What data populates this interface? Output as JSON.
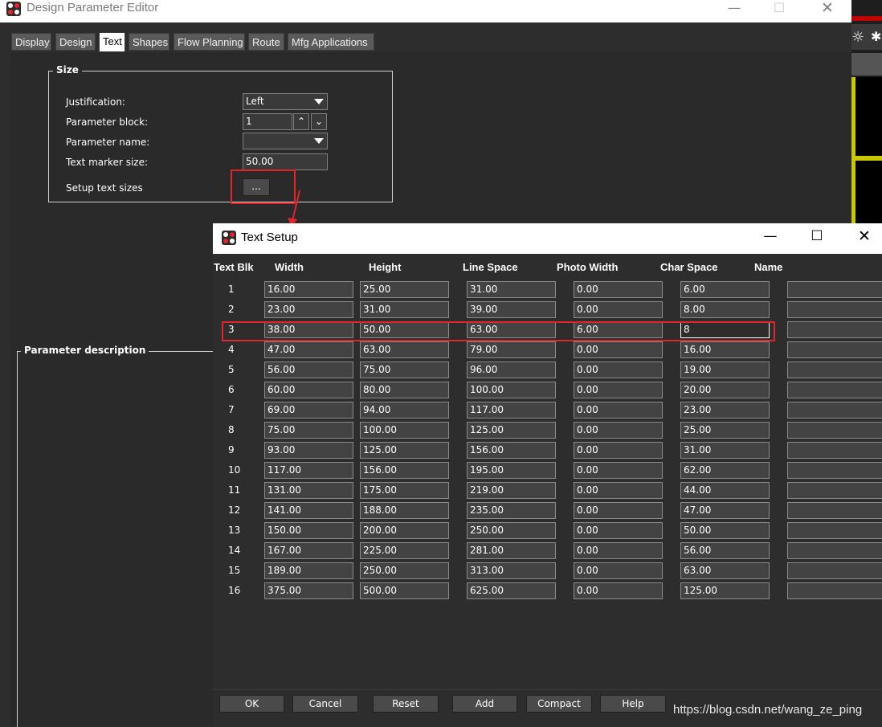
{
  "parent": {
    "title": "Design Parameter Editor",
    "tabs": [
      "Display",
      "Design",
      "Text",
      "Shapes",
      "Flow Planning",
      "Route",
      "Mfg Applications"
    ],
    "active_tab": "Text",
    "size_group": {
      "legend": "Size",
      "justification_label": "Justification:",
      "justification_value": "Left",
      "parameter_block_label": "Parameter block:",
      "parameter_block_value": "1",
      "parameter_name_label": "Parameter name:",
      "parameter_name_value": "",
      "text_marker_label": "Text marker size:",
      "text_marker_value": "50.00",
      "setup_text_label": "Setup text sizes",
      "setup_button": "..."
    },
    "description_group": {
      "legend": "Parameter description"
    }
  },
  "dialog": {
    "title": "Text Setup",
    "columns": [
      "Text Blk",
      "Width",
      "Height",
      "Line Space",
      "Photo Width",
      "Char Space",
      "Name"
    ],
    "rows": [
      {
        "blk": "1",
        "width": "16.00",
        "height": "25.00",
        "line": "31.00",
        "photo": "0.00",
        "char": "6.00",
        "name": ""
      },
      {
        "blk": "2",
        "width": "23.00",
        "height": "31.00",
        "line": "39.00",
        "photo": "0.00",
        "char": "8.00",
        "name": ""
      },
      {
        "blk": "3",
        "width": "38.00",
        "height": "50.00",
        "line": "63.00",
        "photo": "6.00",
        "char": "8",
        "name": ""
      },
      {
        "blk": "4",
        "width": "47.00",
        "height": "63.00",
        "line": "79.00",
        "photo": "0.00",
        "char": "16.00",
        "name": ""
      },
      {
        "blk": "5",
        "width": "56.00",
        "height": "75.00",
        "line": "96.00",
        "photo": "0.00",
        "char": "19.00",
        "name": ""
      },
      {
        "blk": "6",
        "width": "60.00",
        "height": "80.00",
        "line": "100.00",
        "photo": "0.00",
        "char": "20.00",
        "name": ""
      },
      {
        "blk": "7",
        "width": "69.00",
        "height": "94.00",
        "line": "117.00",
        "photo": "0.00",
        "char": "23.00",
        "name": ""
      },
      {
        "blk": "8",
        "width": "75.00",
        "height": "100.00",
        "line": "125.00",
        "photo": "0.00",
        "char": "25.00",
        "name": ""
      },
      {
        "blk": "9",
        "width": "93.00",
        "height": "125.00",
        "line": "156.00",
        "photo": "0.00",
        "char": "31.00",
        "name": ""
      },
      {
        "blk": "10",
        "width": "117.00",
        "height": "156.00",
        "line": "195.00",
        "photo": "0.00",
        "char": "62.00",
        "name": ""
      },
      {
        "blk": "11",
        "width": "131.00",
        "height": "175.00",
        "line": "219.00",
        "photo": "0.00",
        "char": "44.00",
        "name": ""
      },
      {
        "blk": "12",
        "width": "141.00",
        "height": "188.00",
        "line": "235.00",
        "photo": "0.00",
        "char": "47.00",
        "name": ""
      },
      {
        "blk": "13",
        "width": "150.00",
        "height": "200.00",
        "line": "250.00",
        "photo": "0.00",
        "char": "50.00",
        "name": ""
      },
      {
        "blk": "14",
        "width": "167.00",
        "height": "225.00",
        "line": "281.00",
        "photo": "0.00",
        "char": "56.00",
        "name": ""
      },
      {
        "blk": "15",
        "width": "189.00",
        "height": "250.00",
        "line": "313.00",
        "photo": "0.00",
        "char": "63.00",
        "name": ""
      },
      {
        "blk": "16",
        "width": "375.00",
        "height": "500.00",
        "line": "625.00",
        "photo": "0.00",
        "char": "125.00",
        "name": ""
      }
    ],
    "buttons": [
      "OK",
      "Cancel",
      "Reset",
      "Add",
      "Compact",
      "Help"
    ]
  },
  "watermark": "https://blog.csdn.net/wang_ze_ping",
  "colors": {
    "highlight": "#e0252b",
    "panel": "#2a2a2a",
    "cell": "#434343"
  }
}
